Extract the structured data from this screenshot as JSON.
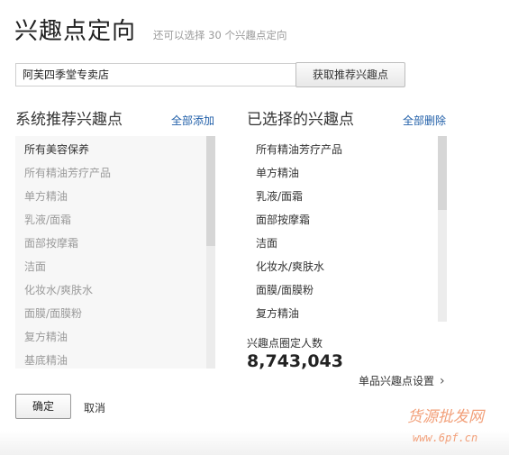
{
  "header": {
    "title": "兴趣点定向",
    "subtitle": "还可以选择 30 个兴趣点定向"
  },
  "search": {
    "value": "阿芙四季堂专卖店",
    "button_label": "获取推荐兴趣点"
  },
  "left_panel": {
    "title": "系统推荐兴趣点",
    "action_label": "全部添加",
    "items": [
      "所有美容保养",
      "所有精油芳疗产品",
      "单方精油",
      "乳液/面霜",
      "面部按摩霜",
      "洁面",
      "化妆水/爽肤水",
      "面膜/面膜粉",
      "复方精油",
      "基底精油"
    ]
  },
  "right_panel": {
    "title": "已选择的兴趣点",
    "action_label": "全部删除",
    "items": [
      "所有精油芳疗产品",
      "单方精油",
      "乳液/面霜",
      "面部按摩霜",
      "洁面",
      "化妆水/爽肤水",
      "面膜/面膜粉",
      "复方精油"
    ]
  },
  "summary": {
    "label": "兴趣点圈定人数",
    "count": "8,743,043",
    "settings_link": "单品兴趣点设置"
  },
  "footer": {
    "ok_label": "确定",
    "cancel_label": "取消"
  },
  "watermark": {
    "line1": "货源批发网",
    "line2": "www.6pf.cn"
  },
  "icons": {
    "settings_chevron": "chevron-right-icon"
  }
}
